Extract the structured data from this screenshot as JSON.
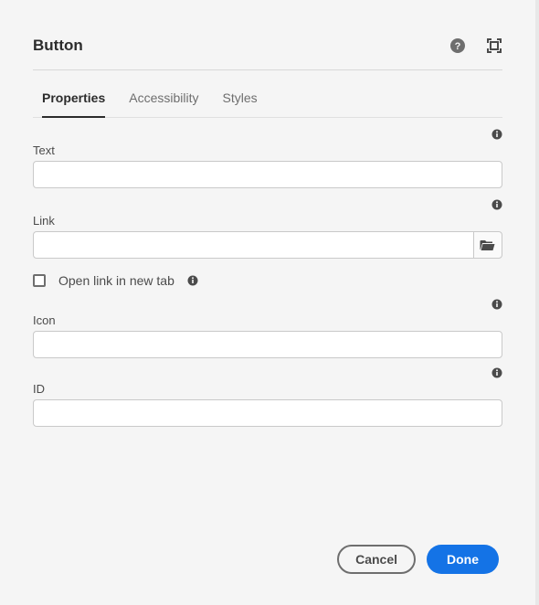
{
  "header": {
    "title": "Button"
  },
  "tabs": [
    {
      "label": "Properties",
      "active": true
    },
    {
      "label": "Accessibility",
      "active": false
    },
    {
      "label": "Styles",
      "active": false
    }
  ],
  "fields": {
    "text": {
      "label": "Text",
      "value": ""
    },
    "link": {
      "label": "Link",
      "value": ""
    },
    "openInNewTab": {
      "label": "Open link in new tab",
      "checked": false
    },
    "icon": {
      "label": "Icon",
      "value": ""
    },
    "id": {
      "label": "ID",
      "value": ""
    }
  },
  "footer": {
    "cancel": "Cancel",
    "done": "Done"
  }
}
